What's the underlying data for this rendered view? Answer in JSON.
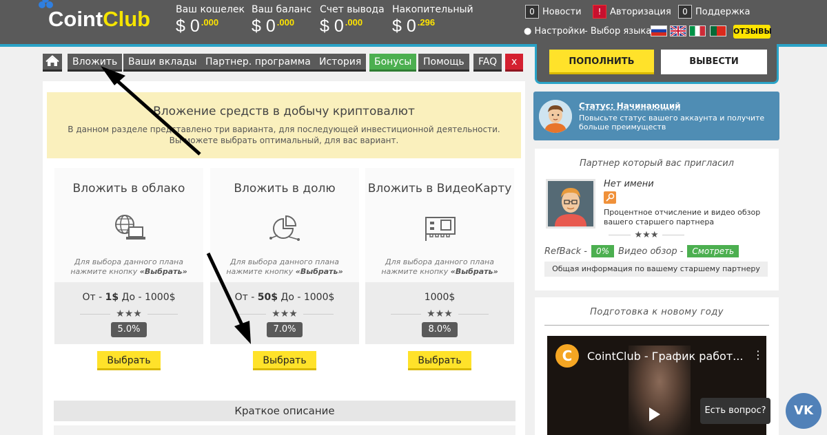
{
  "logo": {
    "part1": "Coint",
    "part2": "Club"
  },
  "header": {
    "stats": [
      {
        "label": "Ваш кошелек",
        "currency": "$",
        "int": "0",
        "frac": ".000"
      },
      {
        "label": "Ваш баланс",
        "currency": "$",
        "int": "0",
        "frac": ".000"
      },
      {
        "label": "Счет вывода",
        "currency": "$",
        "int": "0",
        "frac": ".000"
      },
      {
        "label": "Накопительный",
        "currency": "$",
        "int": "0",
        "frac": ".296"
      }
    ],
    "news": {
      "count": "0",
      "label": "Новости"
    },
    "auth": {
      "badge": "!",
      "label": "Авторизация"
    },
    "support": {
      "count": "0",
      "label": "Поддержка"
    },
    "settings_label": "Настройки",
    "language_label": "- Выбор языка",
    "reviews_label": "ОТЗЫВЫ"
  },
  "actions": {
    "deposit": "ПОПОЛНИТЬ",
    "withdraw": "ВЫВЕСТИ"
  },
  "tabs": {
    "invest": "Вложить",
    "deposits": "Ваши вклады",
    "partner": "Партнер. программа",
    "history": "История",
    "bonuses": "Бонусы",
    "help": "Помощь",
    "faq": "FAQ",
    "close": "x"
  },
  "info": {
    "title": "Вложение средств в добычу криптовалют",
    "text": "В данном разделе представлено три варианта, для последующей инвестиционной деятельности. Вы можете выбрать оптимальный, для вас вариант."
  },
  "cards": [
    {
      "title": "Вложить в облако",
      "hint": "Для выбора данного плана нажмите кнопку",
      "hint_bold": "«Выбрать»",
      "range_prefix": "От - ",
      "range_min": "1$",
      "range_mid": " До - ",
      "range_max": "1000$",
      "stars": "★★★",
      "percent": "5.0%",
      "button": "Выбрать"
    },
    {
      "title": "Вложить в долю",
      "hint": "Для выбора данного плана нажмите кнопку",
      "hint_bold": "«Выбрать»",
      "range_prefix": "От - ",
      "range_min": "50$",
      "range_mid": " До - ",
      "range_max": "1000$",
      "stars": "★★★",
      "percent": "7.0%",
      "button": "Выбрать"
    },
    {
      "title": "Вложить в ВидеоКарту",
      "hint": "Для выбора данного плана нажмите кнопку",
      "hint_bold": "«Выбрать»",
      "range_prefix": "",
      "range_min": "",
      "range_mid": "",
      "range_max": "1000$",
      "stars": "★★★",
      "percent": "8.0%",
      "button": "Выбрать"
    }
  ],
  "short_description": "Краткое описание",
  "status": {
    "title": "Статус: Начинающий",
    "text": "Повысьте статус вашего аккаунта и получите больше преимуществ"
  },
  "partner": {
    "title": "Партнер который вас пригласил",
    "name": "Нет имени",
    "desc": "Процентное отчисление и видео обзор вашего старшего партнера",
    "stars": "★★★",
    "refback_label": "RefBack -",
    "refback_value": "0%",
    "review_label": "Видео обзор -",
    "review_button": "Смотреть",
    "info_button": "Общая информация по вашему старшему партнеру"
  },
  "video": {
    "title": "Подготовка к новому году",
    "channel_letter": "C",
    "caption": "CointClub - График работ...",
    "menu": "⋮"
  },
  "chat": {
    "question": "Есть вопрос?",
    "vk_label": "VK"
  },
  "colors": {
    "header_bg": "#5a5a5a",
    "accent_blue": "#2aa3c7",
    "yellow": "#ffe22a",
    "green": "#4caf50",
    "red": "#d42030"
  }
}
